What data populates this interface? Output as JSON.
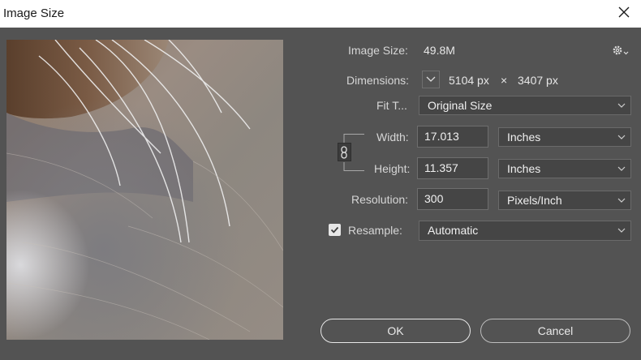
{
  "window": {
    "title": "Image Size"
  },
  "image_size": {
    "label": "Image Size:",
    "value": "49.8M"
  },
  "dimensions": {
    "label": "Dimensions:",
    "width": "5104 px",
    "times": "×",
    "height": "3407 px"
  },
  "fit_to": {
    "label": "Fit T...",
    "value": "Original Size"
  },
  "width": {
    "label": "Width:",
    "value": "17.013",
    "unit": "Inches"
  },
  "height": {
    "label": "Height:",
    "value": "11.357",
    "unit": "Inches"
  },
  "resolution": {
    "label": "Resolution:",
    "value": "300",
    "unit": "Pixels/Inch"
  },
  "resample": {
    "label": "Resample:",
    "checked": true,
    "value": "Automatic"
  },
  "buttons": {
    "ok": "OK",
    "cancel": "Cancel"
  },
  "icons": {
    "settings": "gear-icon",
    "close": "close-icon",
    "link": "chain-link-icon"
  },
  "colors": {
    "panel": "#535353",
    "field": "#454545",
    "titlebar": "#ffffff"
  }
}
